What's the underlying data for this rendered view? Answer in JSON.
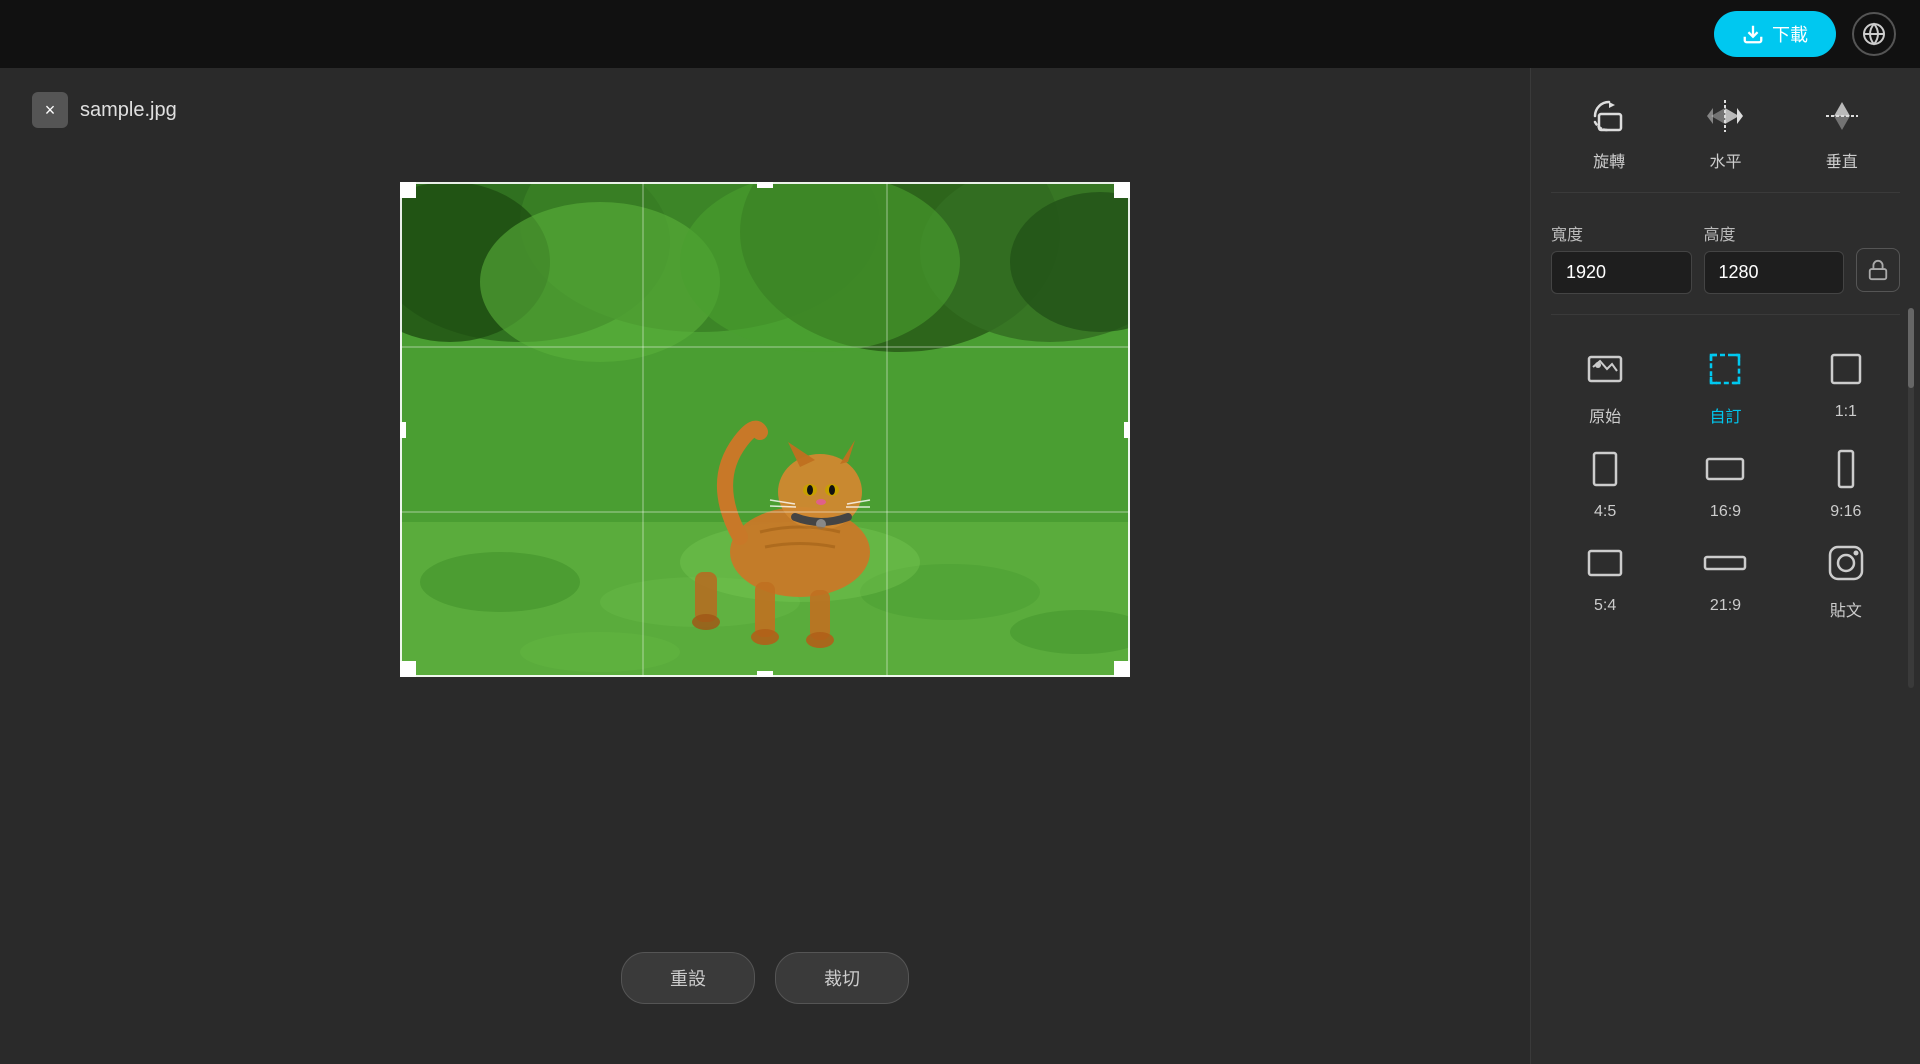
{
  "topbar": {
    "download_label": "下載",
    "download_icon": "⬇"
  },
  "left_panel": {
    "filename": "sample.jpg",
    "close_label": "×",
    "reset_label": "重設",
    "crop_label": "裁切"
  },
  "right_panel": {
    "tools": [
      {
        "id": "rotate",
        "label": "旋轉"
      },
      {
        "id": "horizontal",
        "label": "水平"
      },
      {
        "id": "vertical",
        "label": "垂直"
      }
    ],
    "dims": {
      "width_label": "寬度",
      "height_label": "高度",
      "width_value": "1920",
      "height_value": "1280"
    },
    "ratios": [
      {
        "id": "original",
        "label": "原始",
        "active": false
      },
      {
        "id": "custom",
        "label": "自訂",
        "active": true
      },
      {
        "id": "1:1",
        "label": "1:1",
        "active": false
      },
      {
        "id": "4:5",
        "label": "4:5",
        "active": false
      },
      {
        "id": "16:9",
        "label": "16:9",
        "active": false
      },
      {
        "id": "9:16",
        "label": "9:16",
        "active": false
      },
      {
        "id": "5:4",
        "label": "5:4",
        "active": false
      },
      {
        "id": "21:9",
        "label": "21:9",
        "active": false
      },
      {
        "id": "instagram",
        "label": "貼文",
        "active": false
      }
    ]
  }
}
